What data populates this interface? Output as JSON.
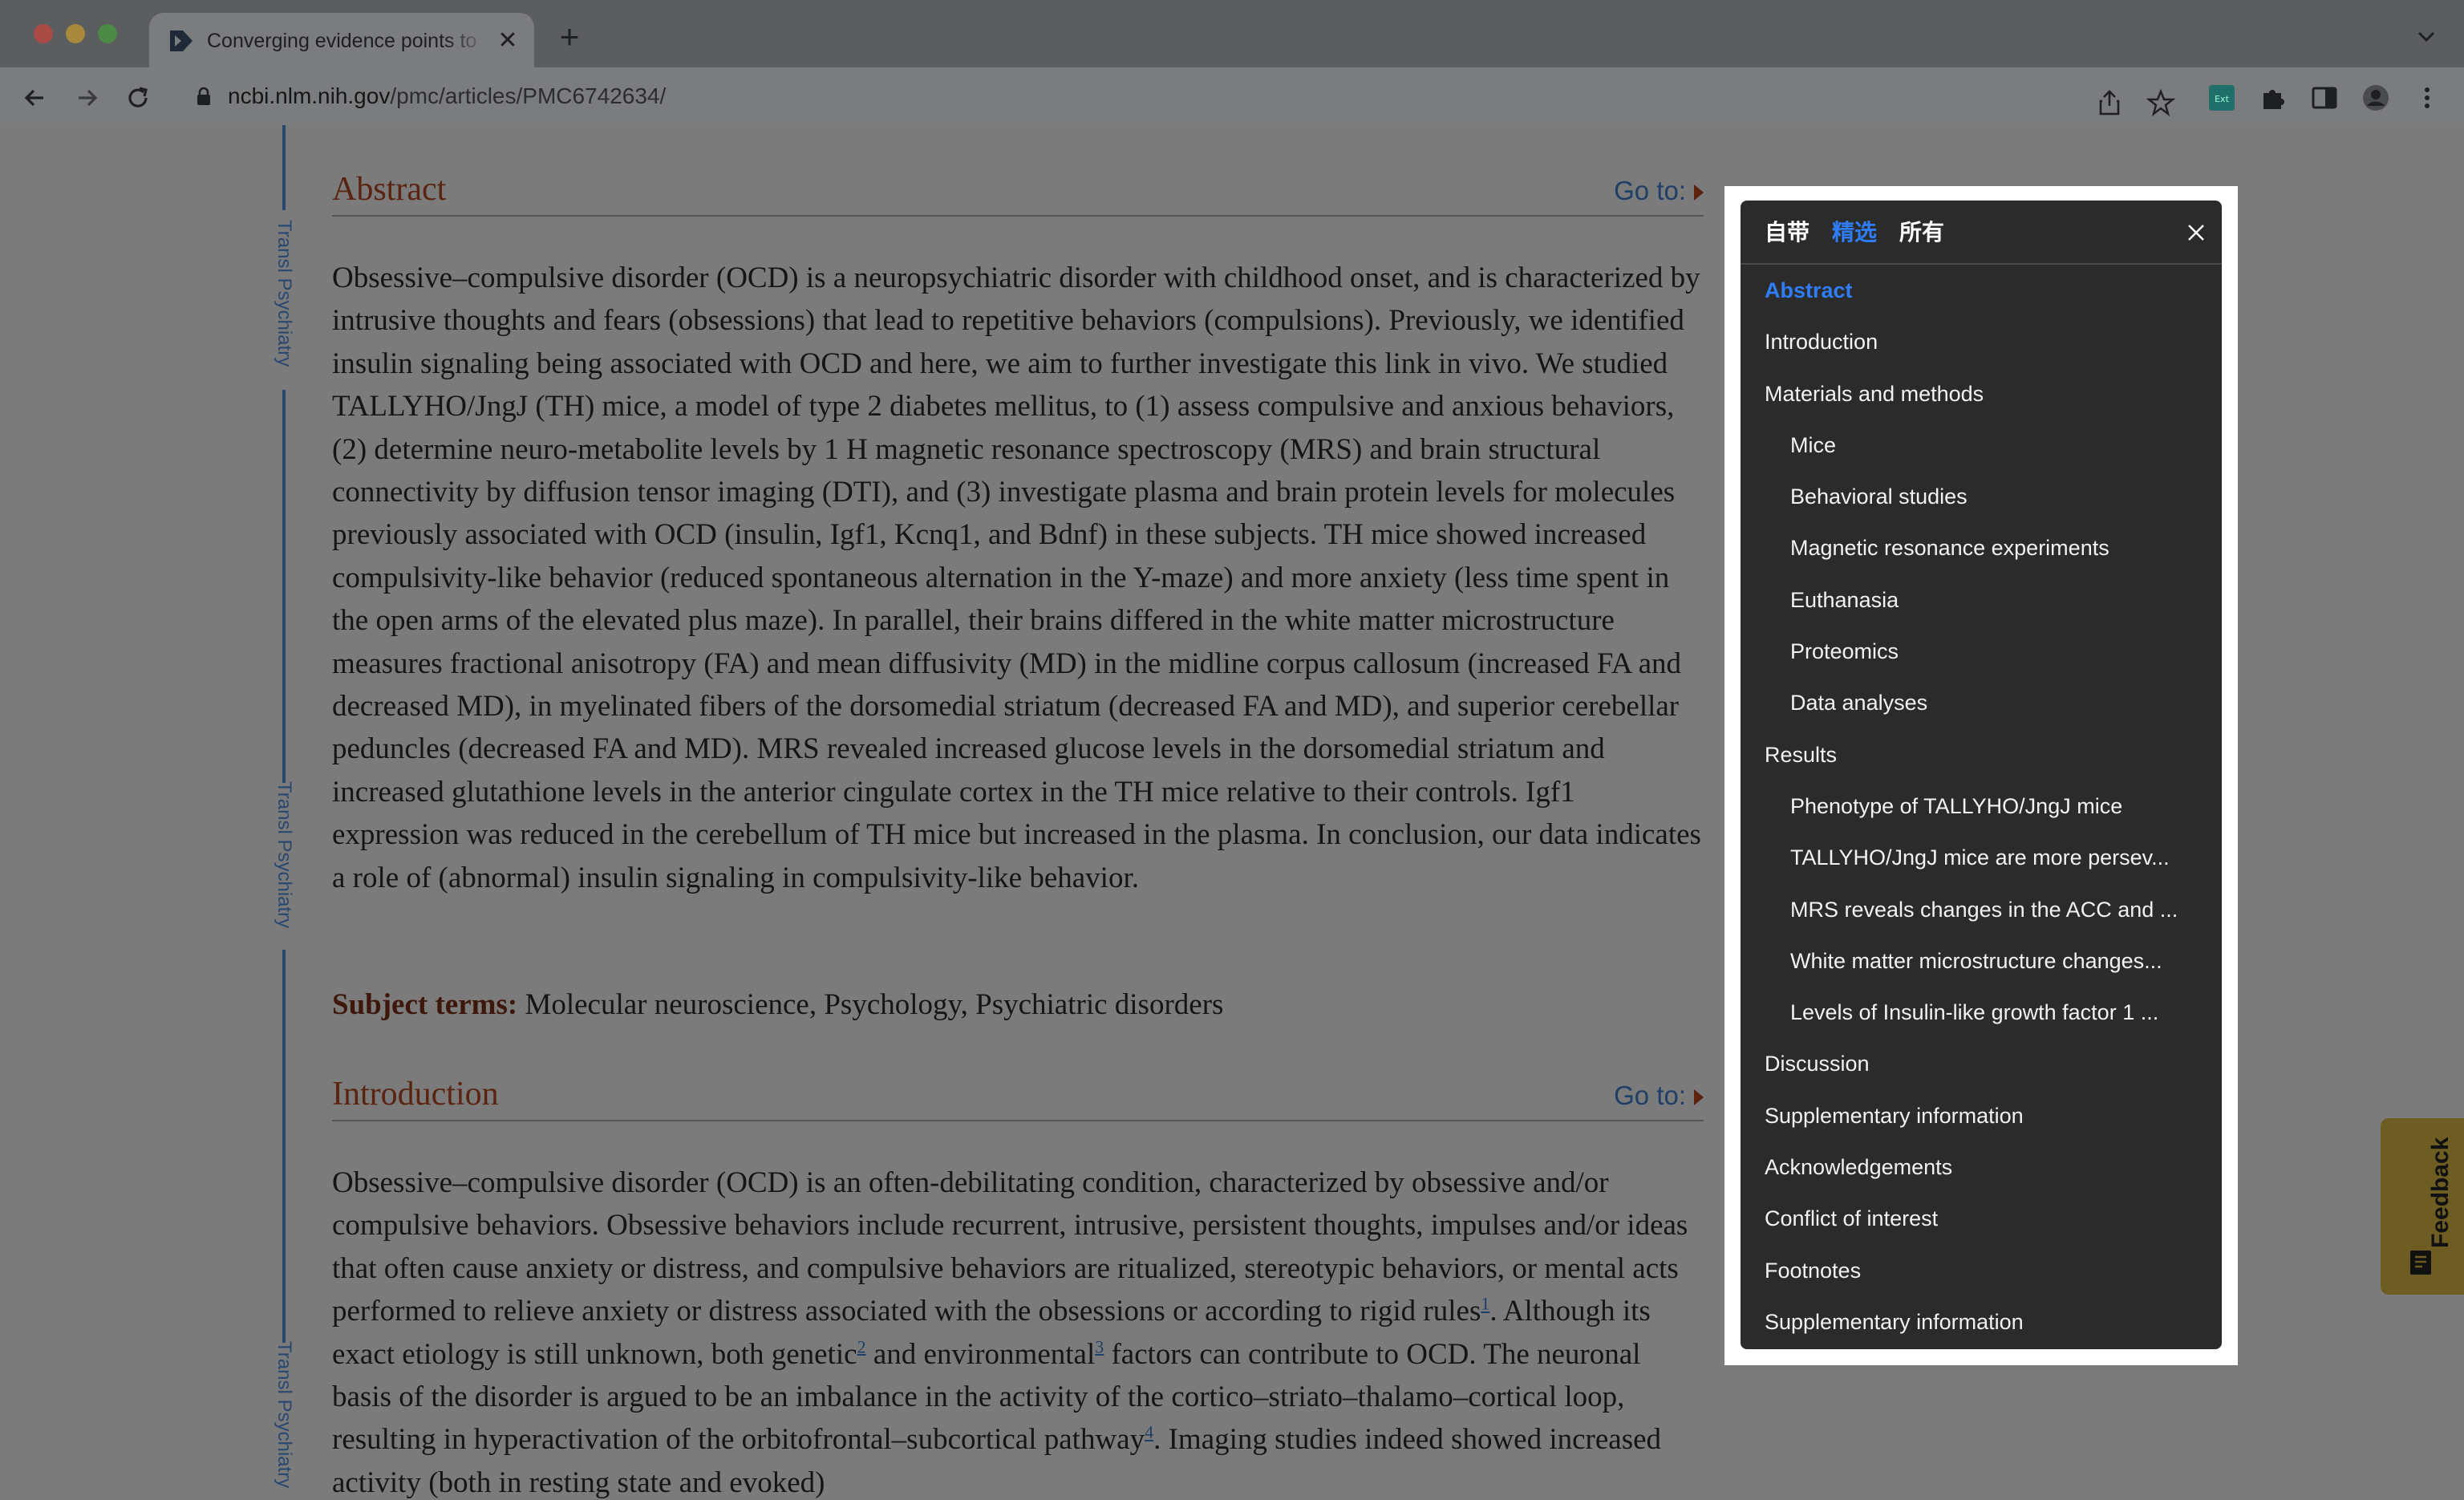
{
  "browser": {
    "tab_title": "Converging evidence points to",
    "url_domain": "ncbi.nlm.nih.gov",
    "url_path": "/pmc/articles/PMC6742634/",
    "tab_close": "✕",
    "new_tab": "+"
  },
  "article": {
    "side_label": "Transl Psychiatry",
    "abstract": {
      "title": "Abstract",
      "goto": "Go to:",
      "text": "Obsessive–compulsive disorder (OCD) is a neuropsychiatric disorder with childhood onset, and is characterized by intrusive thoughts and fears (obsessions) that lead to repetitive behaviors (compulsions). Previously, we identified insulin signaling being associated with OCD and here, we aim to further investigate this link in vivo. We studied TALLYHO/JngJ (TH) mice, a model of type 2 diabetes mellitus, to (1) assess compulsive and anxious behaviors, (2) determine neuro-metabolite levels by 1 H magnetic resonance spectroscopy (MRS) and brain structural connectivity by diffusion tensor imaging (DTI), and (3) investigate plasma and brain protein levels for molecules previously associated with OCD (insulin, Igf1, Kcnq1, and Bdnf) in these subjects. TH mice showed increased compulsivity-like behavior (reduced spontaneous alternation in the Y-maze) and more anxiety (less time spent in the open arms of the elevated plus maze). In parallel, their brains differed in the white matter microstructure measures fractional anisotropy (FA) and mean diffusivity (MD) in the midline corpus callosum (increased FA and decreased MD), in myelinated fibers of the dorsomedial striatum (decreased FA and MD), and superior cerebellar peduncles (decreased FA and MD). MRS revealed increased glucose levels in the dorsomedial striatum and increased glutathione levels in the anterior cingulate cortex in the TH mice relative to their controls. Igf1 expression was reduced in the cerebellum of TH mice but increased in the plasma. In conclusion, our data indicates a role of (abnormal) insulin signaling in compulsivity-like behavior."
    },
    "subject_terms": {
      "label": "Subject terms:",
      "value": " Molecular neuroscience, Psychology, Psychiatric disorders"
    },
    "introduction": {
      "title": "Introduction",
      "goto": "Go to:",
      "part1": "Obsessive–compulsive disorder (OCD) is an often-debilitating condition, characterized by obsessive and/or compulsive behaviors. Obsessive behaviors include recurrent, intrusive, persistent thoughts, impulses and/or ideas that often cause anxiety or distress, and compulsive behaviors are ritualized, stereotypic behaviors, or mental acts performed to relieve anxiety or distress associated with the obsessions or according to rigid rules",
      "ref1": "1",
      "part2": ". Although its exact etiology is still unknown, both genetic",
      "ref2": "2",
      "part3": " and environmental",
      "ref3": "3",
      "part4": " factors can contribute to OCD. The neuronal basis of the disorder is argued to be an imbalance in the activity of the cortico–striato–thalamo–cortical loop, resulting in hyperactivation of the orbitofrontal–subcortical pathway",
      "ref4": "4",
      "part5": ". Imaging studies indeed showed increased activity (both in resting state and evoked)"
    }
  },
  "outline_panel": {
    "tabs": [
      "自带",
      "精选",
      "所有"
    ],
    "active_tab": "精选",
    "items": [
      {
        "label": "Abstract",
        "active": true,
        "level": 1
      },
      {
        "label": "Introduction",
        "level": 1
      },
      {
        "label": "Materials and methods",
        "level": 1
      },
      {
        "label": "Mice",
        "level": 2
      },
      {
        "label": "Behavioral studies",
        "level": 2
      },
      {
        "label": "Magnetic resonance experiments",
        "level": 2
      },
      {
        "label": "Euthanasia",
        "level": 2
      },
      {
        "label": "Proteomics",
        "level": 2
      },
      {
        "label": "Data analyses",
        "level": 2
      },
      {
        "label": "Results",
        "level": 1
      },
      {
        "label": "Phenotype of TALLYHO/JngJ mice",
        "level": 2
      },
      {
        "label": "TALLYHO/JngJ mice are more persev...",
        "level": 2
      },
      {
        "label": "MRS reveals changes in the ACC and ...",
        "level": 2
      },
      {
        "label": "White matter microstructure changes...",
        "level": 2
      },
      {
        "label": "Levels of Insulin-like growth factor 1 ...",
        "level": 2
      },
      {
        "label": "Discussion",
        "level": 1
      },
      {
        "label": "Supplementary information",
        "level": 1
      },
      {
        "label": "Acknowledgements",
        "level": 1
      },
      {
        "label": "Conflict of interest",
        "level": 1
      },
      {
        "label": "Footnotes",
        "level": 1
      },
      {
        "label": "Supplementary information",
        "level": 1
      }
    ],
    "accent_color": "#2f7df6"
  },
  "feedback": {
    "label": "Feedback"
  },
  "icons": {
    "back": "arrow-left-icon",
    "forward": "arrow-right-icon",
    "reload": "reload-icon",
    "lock": "lock-icon",
    "share": "share-icon",
    "bookmark": "star-icon",
    "extension1": "extension-badge-icon",
    "extensions": "puzzle-icon",
    "sidepanel": "side-panel-icon",
    "profile": "profile-icon",
    "menu": "kebab-menu-icon"
  }
}
